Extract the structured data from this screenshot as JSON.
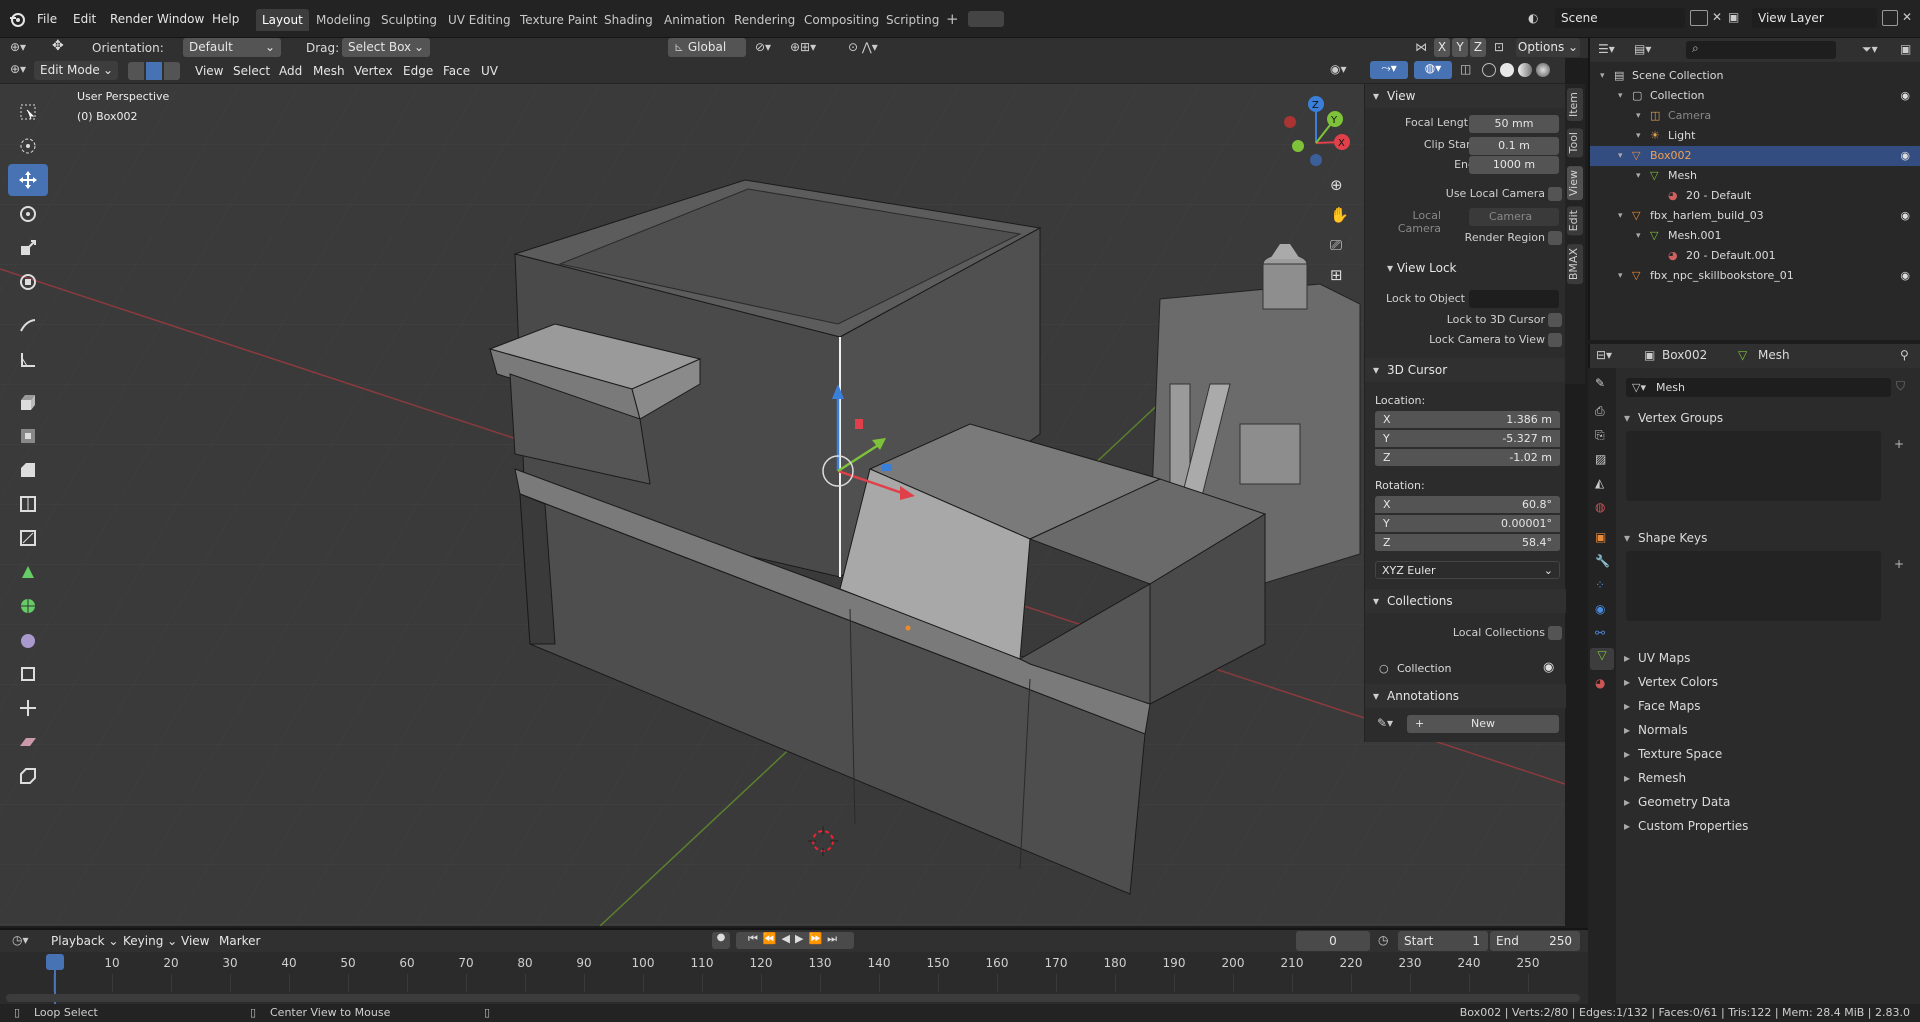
{
  "topbar": {
    "menus": [
      "File",
      "Edit",
      "Render",
      "Window",
      "Help"
    ],
    "workspaces": [
      "Layout",
      "Modeling",
      "Sculpting",
      "UV Editing",
      "Texture Paint",
      "Shading",
      "Animation",
      "Rendering",
      "Compositing",
      "Scripting"
    ],
    "active_workspace": "Layout",
    "scene": "Scene",
    "view_layer": "View Layer"
  },
  "tool_settings": {
    "orientation_label": "Orientation:",
    "orientation_value": "Default",
    "drag_label": "Drag:",
    "drag_value": "Select Box",
    "transform_orientation": "Global",
    "axes": [
      "X",
      "Y",
      "Z"
    ],
    "options_label": "Options"
  },
  "header": {
    "mode": "Edit Mode",
    "menus": [
      "View",
      "Select",
      "Add",
      "Mesh",
      "Vertex",
      "Edge",
      "Face",
      "UV"
    ]
  },
  "viewport": {
    "perspective": "User Perspective",
    "object": "(0) Box002"
  },
  "npanel": {
    "tabs": [
      "Item",
      "Tool",
      "View",
      "Edit",
      "BMAX"
    ],
    "view": {
      "title": "View",
      "focal_length_label": "Focal Length",
      "focal_length": "50 mm",
      "clip_start_label": "Clip Start",
      "clip_start": "0.1 m",
      "end_label": "End",
      "end": "1000 m",
      "use_local_camera": "Use Local Camera",
      "local_camera_label": "Local Camera",
      "local_camera_value": "Camera",
      "render_region": "Render Region"
    },
    "view_lock": {
      "title": "View Lock",
      "lock_to_object": "Lock to Object",
      "lock_to_3d_cursor": "Lock to 3D Cursor",
      "lock_camera_to_view": "Lock Camera to View"
    },
    "cursor": {
      "title": "3D Cursor",
      "location_label": "Location:",
      "location": [
        {
          "axis": "X",
          "value": "1.386 m"
        },
        {
          "axis": "Y",
          "value": "-5.327 m"
        },
        {
          "axis": "Z",
          "value": "-1.02 m"
        }
      ],
      "rotation_label": "Rotation:",
      "rotation": [
        {
          "axis": "X",
          "value": "60.8°"
        },
        {
          "axis": "Y",
          "value": "0.00001°"
        },
        {
          "axis": "Z",
          "value": "58.4°"
        }
      ],
      "rotation_mode": "XYZ Euler"
    },
    "collections": {
      "title": "Collections",
      "local_collections": "Local Collections",
      "item": "Collection"
    },
    "annotations": {
      "title": "Annotations",
      "new_label": "New"
    }
  },
  "outliner": {
    "rows": [
      {
        "label": "Scene Collection",
        "indent": 0,
        "icon": "scene-collection-icon",
        "selected": false
      },
      {
        "label": "Collection",
        "indent": 1,
        "icon": "collection-icon",
        "selected": false
      },
      {
        "label": "Camera",
        "indent": 2,
        "icon": "camera-icon",
        "selected": false
      },
      {
        "label": "Light",
        "indent": 2,
        "icon": "light-icon",
        "selected": false
      },
      {
        "label": "Box002",
        "indent": 1,
        "icon": "mesh-object-icon",
        "selected": true
      },
      {
        "label": "Mesh",
        "indent": 2,
        "icon": "mesh-data-icon",
        "selected": false
      },
      {
        "label": "20 - Default",
        "indent": 3,
        "icon": "material-icon",
        "selected": false
      },
      {
        "label": "fbx_harlem_build_03",
        "indent": 1,
        "icon": "mesh-object-icon",
        "selected": false
      },
      {
        "label": "Mesh.001",
        "indent": 2,
        "icon": "mesh-data-icon",
        "selected": false
      },
      {
        "label": "20 - Default.001",
        "indent": 3,
        "icon": "material-icon",
        "selected": false
      },
      {
        "label": "fbx_npc_skillbookstore_01",
        "indent": 1,
        "icon": "mesh-object-icon",
        "selected": false
      }
    ]
  },
  "properties": {
    "object": "Box002",
    "data": "Mesh",
    "mesh_name": "Mesh",
    "groups": [
      {
        "label": "Vertex Groups",
        "open": true
      },
      {
        "label": "Shape Keys",
        "open": true
      },
      {
        "label": "UV Maps",
        "open": false
      },
      {
        "label": "Vertex Colors",
        "open": false
      },
      {
        "label": "Face Maps",
        "open": false
      },
      {
        "label": "Normals",
        "open": false
      },
      {
        "label": "Texture Space",
        "open": false
      },
      {
        "label": "Remesh",
        "open": false
      },
      {
        "label": "Geometry Data",
        "open": false
      },
      {
        "label": "Custom Properties",
        "open": false
      }
    ]
  },
  "timeline": {
    "menus": [
      "Playback",
      "Keying",
      "View",
      "Marker"
    ],
    "current_frame": "0",
    "start_label": "Start",
    "start": "1",
    "end_label": "End",
    "end": "250",
    "ticks": [
      "0",
      "10",
      "20",
      "30",
      "40",
      "50",
      "60",
      "70",
      "80",
      "90",
      "100",
      "110",
      "120",
      "130",
      "140",
      "150",
      "160",
      "170",
      "180",
      "190",
      "200",
      "210",
      "220",
      "230",
      "240",
      "250"
    ]
  },
  "status": {
    "left_action": "Loop Select",
    "middle_action": "Center View to Mouse",
    "stats": "Box002 | Verts:2/80 | Edges:1/132 | Faces:0/61 | Tris:122 | Mem: 28.4 MiB | 2.83.0"
  },
  "colors": {
    "accent": "#4772b3",
    "x_axis": "#e0404a",
    "y_axis": "#7ec23a",
    "z_axis": "#3a7fd9",
    "selected_row": "#334d80"
  }
}
